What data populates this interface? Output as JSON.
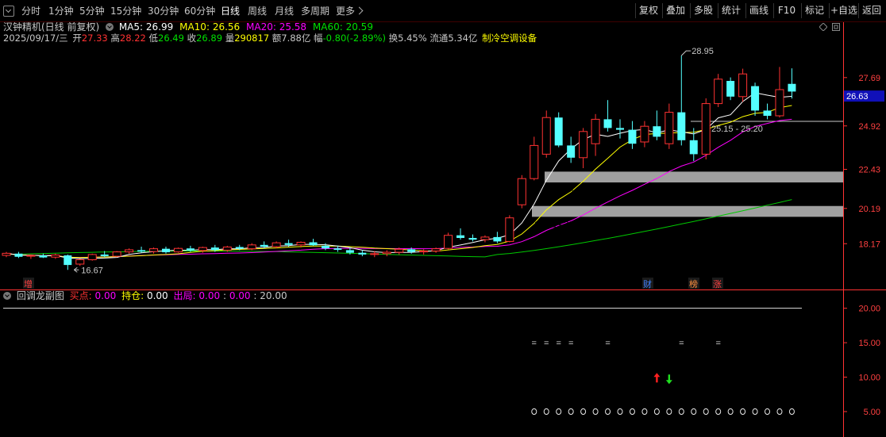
{
  "toolbar": {
    "periods": [
      "分时",
      "1分钟",
      "5分钟",
      "15分钟",
      "30分钟",
      "60分钟",
      "日线",
      "周线",
      "月线",
      "多周期",
      "更多"
    ],
    "active_period": "日线",
    "right_buttons": [
      "复权",
      "叠加",
      "多股",
      "统计",
      "画线",
      "F10",
      "标记",
      "+自选",
      "返回"
    ]
  },
  "stock": {
    "name_line": "汉钟精机(日线 前复权)",
    "date": "2025/09/17/三",
    "open_label": "开",
    "open": "27.33",
    "high_label": "高",
    "high": "28.22",
    "low_label": "低",
    "low": "26.49",
    "close_label": "收",
    "close": "26.89",
    "volume_label": "量",
    "volume": "290817",
    "amount_label": "额",
    "amount": "7.88亿",
    "change_label": "幅",
    "change": "-0.80(-2.89%)",
    "turnover_label": "换",
    "turnover": "5.45%",
    "float_label": "流通",
    "float": "5.34亿",
    "sector": "制冷空调设备"
  },
  "ma": {
    "ma5_label": "MA5:",
    "ma5": "26.99",
    "ma10_label": "MA10:",
    "ma10": "26.56",
    "ma20_label": "MA20:",
    "ma20": "25.58",
    "ma60_label": "MA60:",
    "ma60": "20.59"
  },
  "colors": {
    "up": "#ff3232",
    "down": "#54ffff",
    "ma5": "#ffffff",
    "ma10": "#ffff00",
    "ma20": "#ff00ff",
    "ma60": "#00c800",
    "axis": "#ff3232",
    "band": "#a0a0a0"
  },
  "chart_data": [
    {
      "type": "candlestick",
      "y_ticks": [
        "27.69",
        "24.92",
        "22.43",
        "20.19",
        "18.17"
      ],
      "ylim": [
        16.0,
        29.5
      ],
      "current_price": "26.63",
      "annotations": {
        "max_label": "28.95",
        "min_label": "16.67",
        "band1_label": "25.15 - 25.20",
        "band2_label": "21.68 - 22.30",
        "band3_label": "19.71 - 20.33",
        "markers": [
          "增",
          "财",
          "榜",
          "涨"
        ]
      },
      "candles": [
        [
          17.5,
          17.7,
          17.4,
          17.62
        ],
        [
          17.6,
          17.7,
          17.35,
          17.42
        ],
        [
          17.45,
          17.55,
          17.3,
          17.5
        ],
        [
          17.5,
          17.6,
          17.35,
          17.38
        ],
        [
          17.4,
          17.6,
          17.3,
          17.52
        ],
        [
          17.5,
          17.55,
          16.67,
          16.95
        ],
        [
          17.0,
          17.3,
          16.9,
          17.25
        ],
        [
          17.25,
          17.6,
          17.2,
          17.55
        ],
        [
          17.55,
          17.75,
          17.4,
          17.45
        ],
        [
          17.45,
          17.75,
          17.4,
          17.7
        ],
        [
          17.7,
          17.9,
          17.6,
          17.82
        ],
        [
          17.8,
          18.0,
          17.65,
          17.72
        ],
        [
          17.72,
          17.95,
          17.6,
          17.88
        ],
        [
          17.88,
          18.0,
          17.6,
          17.68
        ],
        [
          17.7,
          17.95,
          17.65,
          17.9
        ],
        [
          17.9,
          18.05,
          17.7,
          17.78
        ],
        [
          17.78,
          18.0,
          17.65,
          17.95
        ],
        [
          17.95,
          18.1,
          17.7,
          17.8
        ],
        [
          17.8,
          18.05,
          17.7,
          17.98
        ],
        [
          17.98,
          18.1,
          17.8,
          17.88
        ],
        [
          17.88,
          18.2,
          17.8,
          18.1
        ],
        [
          18.1,
          18.3,
          17.9,
          18.0
        ],
        [
          18.0,
          18.3,
          17.9,
          18.22
        ],
        [
          18.2,
          18.4,
          18.0,
          18.1
        ],
        [
          18.1,
          18.3,
          17.95,
          18.25
        ],
        [
          18.25,
          18.45,
          18.05,
          18.08
        ],
        [
          18.05,
          18.2,
          17.8,
          17.9
        ],
        [
          17.9,
          18.05,
          17.7,
          17.82
        ],
        [
          17.8,
          17.95,
          17.55,
          17.65
        ],
        [
          17.65,
          17.8,
          17.45,
          17.55
        ],
        [
          17.55,
          17.75,
          17.4,
          17.6
        ],
        [
          17.6,
          17.8,
          17.45,
          17.68
        ],
        [
          17.68,
          17.95,
          17.55,
          17.85
        ],
        [
          17.85,
          17.95,
          17.6,
          17.7
        ],
        [
          17.7,
          17.85,
          17.55,
          17.75
        ],
        [
          17.75,
          17.95,
          17.65,
          17.88
        ],
        [
          17.9,
          18.8,
          17.85,
          18.65
        ],
        [
          18.65,
          19.05,
          18.4,
          18.5
        ],
        [
          18.5,
          18.7,
          18.3,
          18.4
        ],
        [
          18.4,
          18.65,
          18.25,
          18.55
        ],
        [
          18.55,
          18.85,
          18.2,
          18.3
        ],
        [
          18.3,
          19.8,
          18.25,
          19.65
        ],
        [
          20.4,
          22.1,
          20.2,
          21.9
        ],
        [
          21.9,
          24.3,
          21.8,
          23.8
        ],
        [
          23.3,
          25.8,
          23.1,
          25.4
        ],
        [
          25.4,
          25.7,
          23.7,
          23.8
        ],
        [
          23.8,
          24.3,
          22.8,
          23.1
        ],
        [
          23.1,
          24.8,
          22.5,
          24.6
        ],
        [
          23.9,
          25.6,
          23.2,
          25.3
        ],
        [
          25.3,
          26.4,
          24.6,
          24.8
        ],
        [
          24.8,
          25.3,
          24.2,
          24.7
        ],
        [
          24.7,
          25.2,
          23.6,
          23.9
        ],
        [
          24.0,
          25.2,
          23.7,
          24.9
        ],
        [
          24.9,
          25.8,
          24.1,
          24.3
        ],
        [
          23.9,
          26.2,
          23.6,
          25.7
        ],
        [
          25.7,
          28.95,
          23.8,
          24.1
        ],
        [
          24.1,
          24.8,
          22.9,
          23.3
        ],
        [
          23.3,
          26.5,
          23.0,
          26.2
        ],
        [
          26.2,
          27.9,
          26.0,
          27.6
        ],
        [
          27.5,
          27.7,
          26.4,
          26.6
        ],
        [
          26.6,
          28.2,
          26.3,
          27.9
        ],
        [
          27.2,
          27.4,
          25.5,
          25.8
        ],
        [
          25.8,
          26.2,
          25.3,
          25.5
        ],
        [
          25.5,
          28.3,
          25.4,
          27.0
        ],
        [
          27.33,
          28.22,
          26.49,
          26.89
        ]
      ]
    },
    {
      "type": "signal-indicator",
      "name": "回调龙副图",
      "buy_label": "买点:",
      "buy": "0.00",
      "hold_label": "持仓:",
      "hold": "0.00",
      "out_label": "出局:",
      "out": "0.00",
      "extra1": "0.00",
      "extra2": "20.00",
      "y_ticks": [
        "20.00",
        "15.00",
        "10.00",
        "5.00"
      ],
      "ylim": [
        2.0,
        21.0
      ],
      "line_value": 20,
      "eq_bars": [
        43,
        44,
        45,
        46,
        49,
        55,
        58
      ],
      "eq_value": 15,
      "up_arrow_bar": 53,
      "down_arrow_bar": 54,
      "arrow_value": 9.8,
      "circle_from_bar": 43,
      "circle_value": 5
    }
  ]
}
